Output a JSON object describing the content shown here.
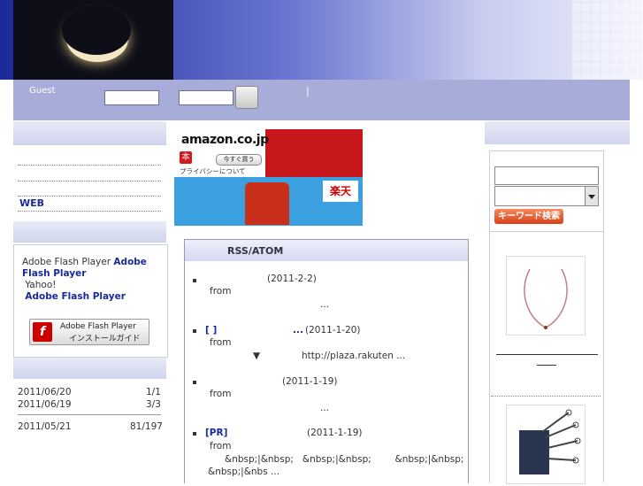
{
  "header": {
    "guest_label": "Guest",
    "separator": "|"
  },
  "left": {
    "menu": [
      {
        "label": ""
      },
      {
        "label": ""
      },
      {
        "label": ""
      },
      {
        "label": "WEB"
      }
    ],
    "flash": {
      "line1a": "Adobe Flash Player",
      "line1b": "Adobe Flash Player",
      "line2": "Yahoo!",
      "line3": "Adobe Flash Player",
      "button_line1": "Adobe Flash Player",
      "button_line2": "インストールガイド"
    },
    "history": [
      {
        "date": "2011/06/20",
        "count": "1/1"
      },
      {
        "date": "2011/06/19",
        "count": "3/3"
      },
      {
        "date": "2011/05/21",
        "count": "81/197"
      }
    ]
  },
  "ads": {
    "amazon_logo": "amazon.co.jp",
    "amazon_badge": "本",
    "amazon_buy": "今すぐ買う",
    "amazon_privacy": "プライバシーについて",
    "rakuten_logo": "楽天"
  },
  "rss": {
    "title": "RSS/ATOM",
    "items": [
      {
        "tag": "",
        "date": "(2011-2-2)",
        "from": "from",
        "excerpt": "..."
      },
      {
        "tag": "[ ]",
        "extra": "...",
        "date": "(2011-1-20)",
        "from": "from",
        "excerpt_mark": "▼",
        "excerpt": "http://plaza.rakuten ..."
      },
      {
        "tag": "",
        "date": "(2011-1-19)",
        "from": "from",
        "excerpt": "..."
      },
      {
        "tag": "[PR]",
        "date": "(2011-1-19)",
        "from": "from",
        "excerpt_line1": "&nbsp;|&nbsp;   &nbsp;|&nbsp;        &nbsp;|&nbsp;",
        "excerpt_line2": "&nbsp;|&nbs ..."
      }
    ]
  },
  "right": {
    "keyword_button": "キーワード検索"
  }
}
